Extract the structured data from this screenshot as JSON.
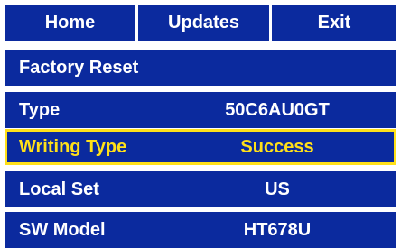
{
  "tabs": [
    {
      "label": "Home"
    },
    {
      "label": "Updates"
    },
    {
      "label": "Exit"
    }
  ],
  "rows": [
    {
      "label": "Factory Reset",
      "value": ""
    },
    {
      "label": "Type",
      "value": "50C6AU0GT"
    },
    {
      "label": "Writing Type",
      "value": "Success"
    },
    {
      "label": "Local Set",
      "value": "US"
    },
    {
      "label": "SW Model",
      "value": "HT678U"
    }
  ],
  "selected_row": "Writing Type",
  "colors": {
    "menu_blue": "#0b2a9e",
    "text_white": "#ffffff",
    "highlight_yellow": "#ffe019"
  }
}
